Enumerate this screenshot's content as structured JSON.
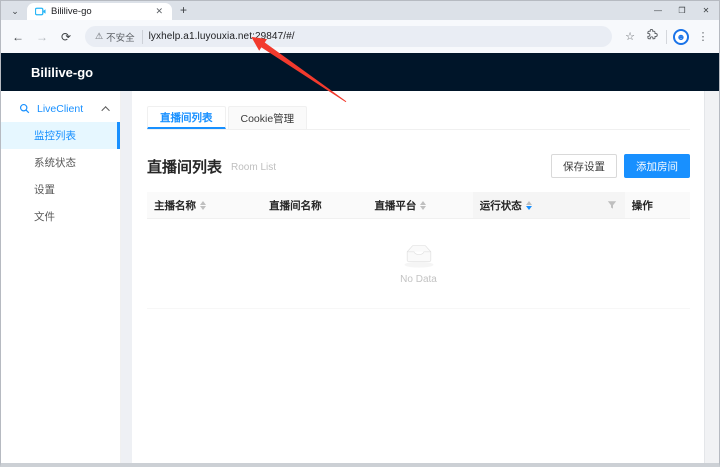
{
  "browser": {
    "tab_title": "Bililive-go",
    "new_tab_label": "+",
    "tab_close_label": "✕",
    "tab_search_label": "⌄",
    "back_label": "←",
    "forward_label": "→",
    "reload_label": "⟳",
    "security_label": "不安全",
    "warning_glyph": "⚠",
    "url": "lyxhelp.a1.luyouxia.net:29847/#/",
    "star_label": "☆",
    "menu_label": "⋮",
    "window_controls": {
      "minimize": "—",
      "maximize": "❒",
      "close": "✕"
    }
  },
  "app": {
    "title": "Bililive-go"
  },
  "sidebar": {
    "group_label": "LiveClient",
    "items": [
      {
        "label": "监控列表",
        "selected": true
      },
      {
        "label": "系统状态",
        "selected": false
      },
      {
        "label": "设置",
        "selected": false
      },
      {
        "label": "文件",
        "selected": false
      }
    ]
  },
  "main": {
    "tabs": [
      {
        "label": "直播间列表",
        "active": true
      },
      {
        "label": "Cookie管理",
        "active": false
      }
    ],
    "page_title": "直播间列表",
    "page_subtitle": "Room List",
    "buttons": {
      "save": "保存设置",
      "add": "添加房间"
    },
    "table": {
      "columns": [
        {
          "label": "主播名称",
          "sortable": true
        },
        {
          "label": "直播间名称",
          "sortable": false
        },
        {
          "label": "直播平台",
          "sortable": true
        },
        {
          "label": "运行状态",
          "sortable": true,
          "sort_order": "descend",
          "filterable": true
        },
        {
          "label": "操作",
          "sortable": false
        }
      ],
      "empty_text": "No Data"
    }
  },
  "colors": {
    "primary": "#1890ff",
    "header_bg": "#001529",
    "selected_bg": "#e6f7ff",
    "annotation_arrow": "#f23a2d"
  }
}
